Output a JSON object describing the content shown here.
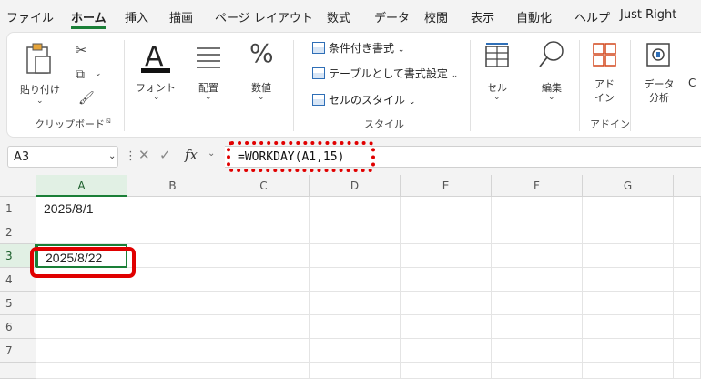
{
  "menu": {
    "items": [
      "ファイル",
      "ホーム",
      "挿入",
      "描画",
      "ページ レイアウト",
      "数式",
      "データ",
      "校閲",
      "表示",
      "自動化",
      "ヘルプ",
      "Just Right"
    ]
  },
  "ribbon": {
    "clipboard": {
      "paste_label": "貼り付け",
      "group_label": "クリップボード"
    },
    "font_label": "フォント",
    "alignment_label": "配置",
    "number_label": "数値",
    "styles": {
      "conditional_format": "条件付き書式",
      "format_as_table": "テーブルとして書式設定",
      "cell_styles": "セルのスタイル",
      "group_label": "スタイル"
    },
    "cells_label": "セル",
    "editing_label": "編集",
    "addins": {
      "button_label_1": "アド",
      "button_label_2": "イン",
      "group_label": "アドイン"
    },
    "analyze": {
      "label_1": "データ",
      "label_2": "分析",
      "cut_label": "C"
    }
  },
  "formula_bar": {
    "name_box": "A3",
    "formula": "=WORKDAY(A1,15)",
    "fx_label": "fx"
  },
  "sheet": {
    "columns": [
      "A",
      "B",
      "C",
      "D",
      "E",
      "F",
      "G"
    ],
    "rows": [
      "1",
      "2",
      "3",
      "4",
      "5",
      "6",
      "7"
    ],
    "cells": {
      "A1": "2025/8/1",
      "A3": "2025/8/22"
    },
    "colors": {
      "accent": "#1a7f37",
      "highlight": "#e00000"
    }
  }
}
